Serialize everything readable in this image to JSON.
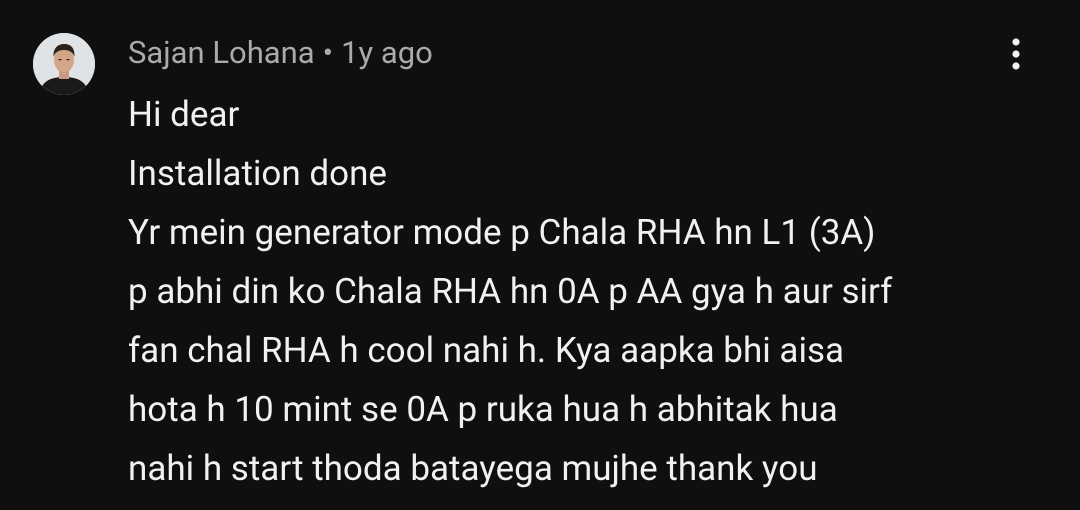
{
  "comment": {
    "author": "Sajan Lohana",
    "separator": "•",
    "timestamp": "1y ago",
    "lines": [
      "Hi dear",
      "Installation done",
      "Yr mein generator mode p Chala RHA hn L1 (3A)",
      "p abhi din ko Chala RHA hn 0A p AA gya h aur sirf",
      "fan chal RHA h cool nahi h. Kya aapka bhi aisa",
      "hota h 10 mint se 0A p ruka hua h abhitak hua",
      "nahi h start thoda batayega mujhe thank you"
    ],
    "more_icon": "vertical-ellipsis-icon"
  },
  "colors": {
    "background": "#0f0f0f",
    "text": "#f1f1f1",
    "meta": "#aaaaaa"
  }
}
